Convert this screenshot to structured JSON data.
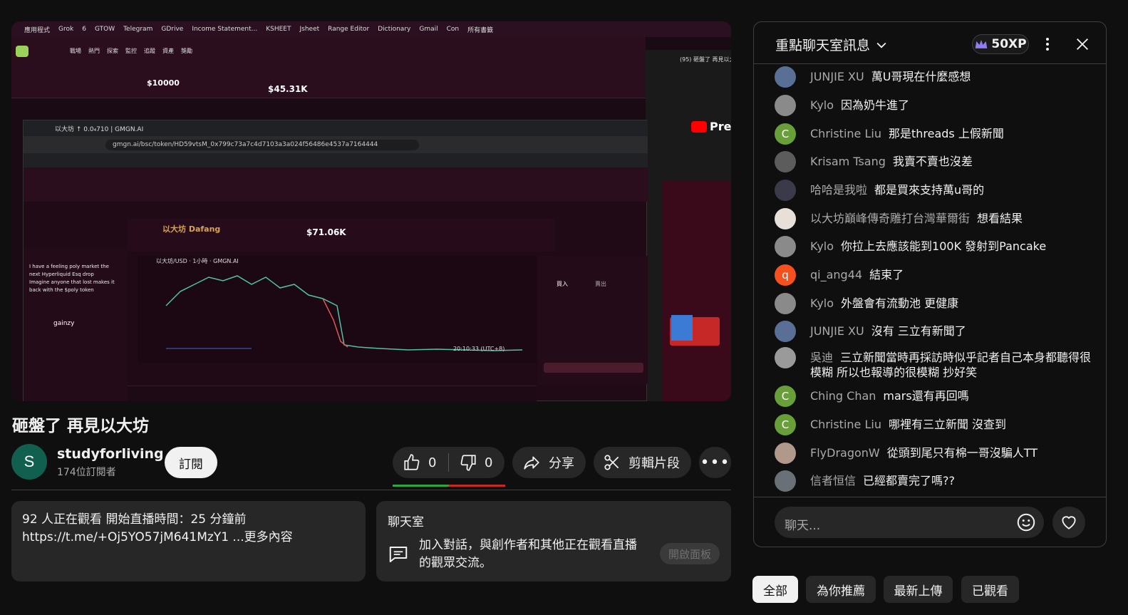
{
  "video": {
    "bookmarks": [
      "應用程式",
      "Grok",
      "6",
      "GTOW",
      "Telegram",
      "GDrive",
      "Income Statement...",
      "KSHEET",
      "Jsheet",
      "Range Editor",
      "Dictionary",
      "Gmail",
      "Con",
      "所有書籤"
    ],
    "nav_items": [
      "戰場",
      "熱門",
      "探索",
      "監控",
      "追蹤",
      "資產",
      "獎勵"
    ],
    "top_price": "$10000",
    "top_mcap": "$45.31K",
    "url": "gmgn.ai/bsc/token/HD59vtsM_0x799c73a7c4d7103a3a024f56486e4537a7164444",
    "tab_title": "以大坊 ↑ 0.0₄710 | GMGN.AI",
    "token_name": "以大坊 Dafang",
    "token_mcap": "$71.06K",
    "chart_title": "以大坊/USD · 1小時 · GMGN.AI",
    "side_title": "(95) 砸盤了 再見以大",
    "premium": "Prem",
    "buy_label": "買入",
    "sell_label": "賣出",
    "chart_time": "20:10:33 (UTC+8)",
    "feed_user": "gainzy",
    "feed_text": "I have a feeling poly market the next Hyperliquid Esq drop Imagine anyone that lost makes it back with the $poly token"
  },
  "title": "砸盤了 再見以大坊",
  "channel": {
    "avatar_letter": "S",
    "name": "studyforliving",
    "subscribers": "174位訂閱者",
    "subscribe_label": "訂閱"
  },
  "actions": {
    "like_count": "0",
    "dislike_count": "0",
    "share_label": "分享",
    "clip_label": "剪輯片段",
    "like_ratio": 0.5
  },
  "description": {
    "line1": "92 人正在觀看  開始直播時間：25 分鐘前",
    "line2": "https://t.me/+Oj5YO57jM641MzY1 ...更多內容"
  },
  "chat_promo": {
    "title": "聊天室",
    "text": "加入對話，與創作者和其他正在觀看直播的觀眾交流。",
    "button": "開啟面板"
  },
  "chat": {
    "header": "重點聊天室訊息",
    "xp": "50XP",
    "input_placeholder": "聊天...",
    "messages": [
      {
        "author": "JUNJIE XU",
        "text": "萬U哥現在什麼感想",
        "avatar": "",
        "color": "#5a6f96"
      },
      {
        "author": "Kylo",
        "text": "因為奶牛進了",
        "avatar": "",
        "color": "#8a8a8a"
      },
      {
        "author": "Christine Liu",
        "text": "那是threads 上假新聞",
        "avatar": "C",
        "color": "#689f38"
      },
      {
        "author": "Krisam Tsang",
        "text": "我賣不賣也沒差",
        "avatar": "",
        "color": "#5c5c5c"
      },
      {
        "author": "哈哈是我啦",
        "text": "都是買來支持萬u哥的",
        "avatar": "",
        "color": "#3a3a4a"
      },
      {
        "author": "以大坊巔峰傳奇雕打台灣華爾街",
        "text": "想看結果",
        "avatar": "",
        "color": "#e8e0d8"
      },
      {
        "author": "Kylo",
        "text": "你拉上去應該能到100K 發射到Pancake",
        "avatar": "",
        "color": "#8a8a8a"
      },
      {
        "author": "qi_ang44",
        "text": "結束了",
        "avatar": "q",
        "color": "#f4511e"
      },
      {
        "author": "Kylo",
        "text": "外盤會有流動池 更健康",
        "avatar": "",
        "color": "#8a8a8a"
      },
      {
        "author": "JUNJIE XU",
        "text": "沒有 三立有新聞了",
        "avatar": "",
        "color": "#5a6f96"
      },
      {
        "author": "吳迪",
        "text": "三立新聞當時再採訪時似乎記者自己本身都聽得很模糊 所以也報導的很模糊 抄好笑",
        "avatar": "",
        "color": "#9a9a9a"
      },
      {
        "author": "Ching Chan",
        "text": "mars還有再回嗎",
        "avatar": "C",
        "color": "#689f38"
      },
      {
        "author": "Christine Liu",
        "text": "哪裡有三立新聞 沒查到",
        "avatar": "C",
        "color": "#689f38"
      },
      {
        "author": "FlyDragonW",
        "text": "從頭到尾只有棉一哥沒騙人TT",
        "avatar": "",
        "color": "#b0988a"
      },
      {
        "author": "信者恒信",
        "text": "已經都賣完了嗎??",
        "avatar": "",
        "color": "#6a7078"
      }
    ]
  },
  "chips": [
    "全部",
    "為你推薦",
    "最新上傳",
    "已觀看"
  ]
}
